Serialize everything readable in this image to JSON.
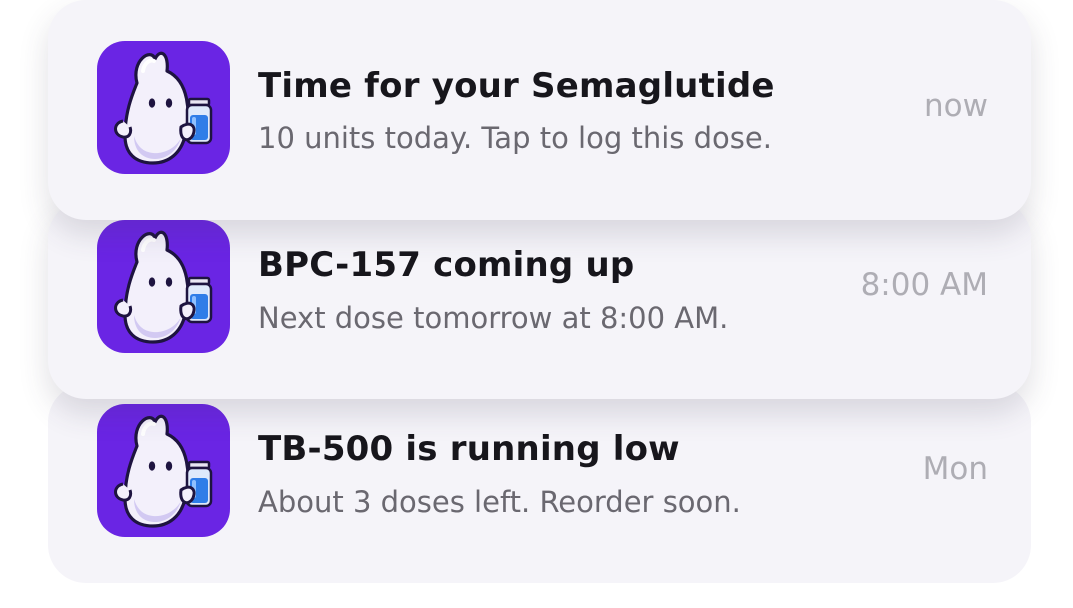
{
  "notifications": [
    {
      "title": "Time for your Semaglutide",
      "body": "10 units today. Tap to log this dose.",
      "time": "now"
    },
    {
      "title": "BPC-157 coming up",
      "body": "Next dose tomorrow at 8:00 AM.",
      "time": "8:00 AM"
    },
    {
      "title": "TB-500 is running low",
      "body": "About 3 doses left. Reorder soon.",
      "time": "Mon"
    }
  ],
  "app_icon": {
    "icon": "ghost-mascot-holding-vial-icon",
    "background_color": "#6a25e4",
    "vial_color": "#2f7de8"
  },
  "colors": {
    "card_background": "#f5f4f9",
    "title_text": "#17161c",
    "body_text": "#6a6870",
    "time_text": "#aeadb4"
  }
}
